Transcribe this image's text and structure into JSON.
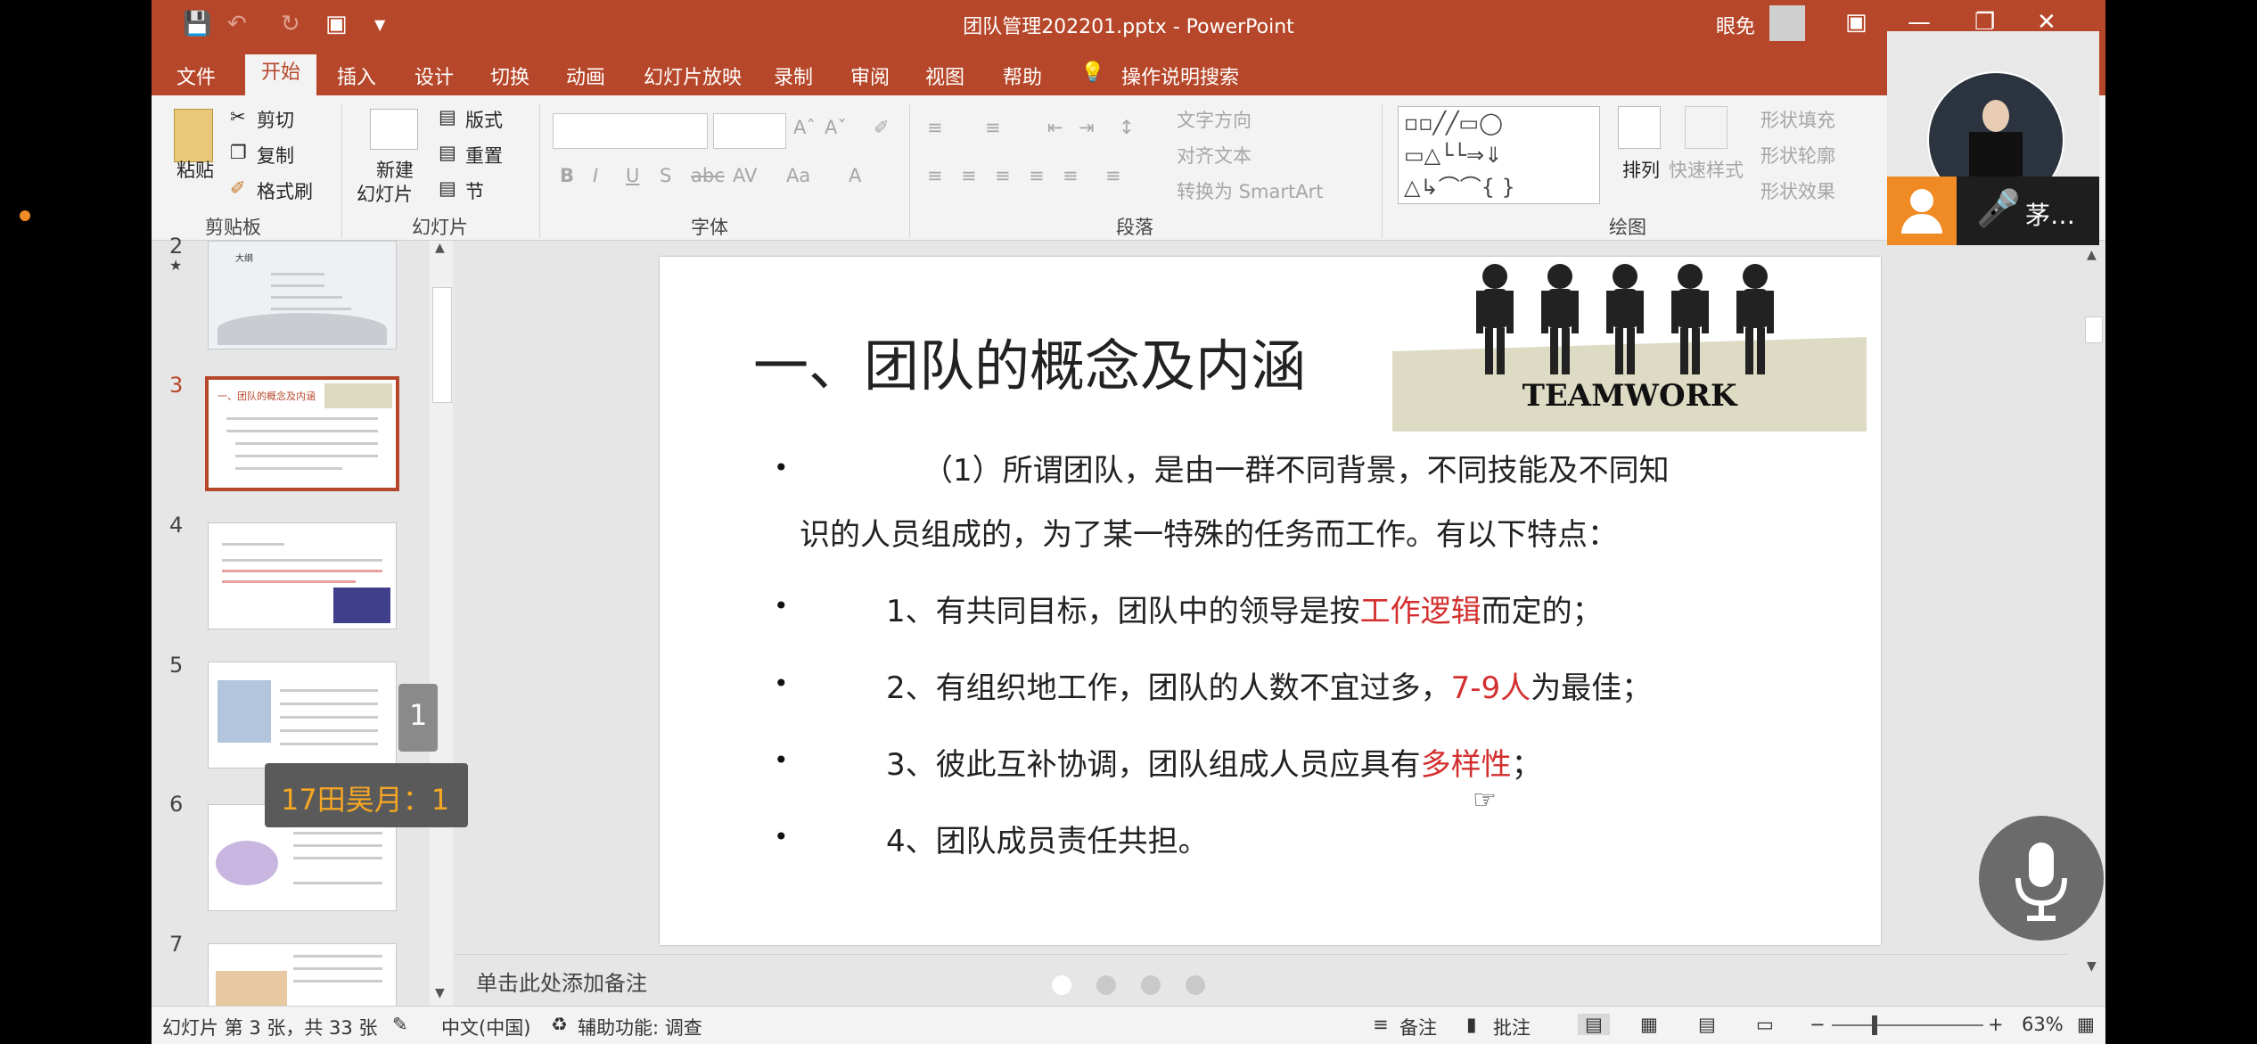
{
  "window": {
    "title": "团队管理202201.pptx - PowerPoint",
    "user": "眼免"
  },
  "tabs": [
    "文件",
    "开始",
    "插入",
    "设计",
    "切换",
    "动画",
    "幻灯片放映",
    "录制",
    "审阅",
    "视图",
    "帮助",
    "操作说明搜索"
  ],
  "ribbon": {
    "clipboard": {
      "paste": "粘贴",
      "cut": "剪切",
      "copy": "复制",
      "format_painter": "格式刷",
      "group": "剪贴板"
    },
    "slides": {
      "new_slide_line1": "新建",
      "new_slide_line2": "幻灯片",
      "layout": "版式",
      "reset": "重置",
      "section": "节",
      "group": "幻灯片"
    },
    "font": {
      "group": "字体",
      "bold": "B",
      "italic": "I",
      "underline": "U",
      "shadow": "S",
      "strike": "abc",
      "spacing": "AV",
      "case": "Aa",
      "color": "A"
    },
    "paragraph": {
      "text_direction": "文字方向",
      "align_text": "对齐文本",
      "convert_smartart": "转换为 SmartArt",
      "group": "段落"
    },
    "drawing": {
      "arrange": "排列",
      "quick_styles": "快速样式",
      "shape_fill": "形状填充",
      "shape_outline": "形状轮廓",
      "shape_effects": "形状效果",
      "group": "绘图"
    }
  },
  "thumbnails": [
    {
      "num": "2",
      "star": "★",
      "title": "大纲"
    },
    {
      "num": "3",
      "title": "一、团队的概念及内涵"
    },
    {
      "num": "4"
    },
    {
      "num": "5"
    },
    {
      "num": "6"
    },
    {
      "num": "7"
    }
  ],
  "slide": {
    "title": "一、团队的概念及内涵",
    "teamwork_label": "TEAMWORK",
    "bullet": "•",
    "p1_line1": "（1）所谓团队，是由一群不同背景，不同技能及不同知",
    "p1_line2": "识的人员组成的，为了某一特殊的任务而工作。有以下特点：",
    "p2_a": "1、有共同目标，团队中的领导是按",
    "p2_red": "工作逻辑",
    "p2_b": "而定的；",
    "p3_a": "2、有组织地工作，团队的人数不宜过多，",
    "p3_red": "7-9人",
    "p3_b": "为最佳；",
    "p4_a": "3、彼此互补协调，团队组成人员应具有",
    "p4_red": "多样性",
    "p4_b": "；",
    "p5": "4、团队成员责任共担。"
  },
  "notes_placeholder": "单击此处添加备注",
  "status": {
    "slide_info": "幻灯片 第 3 张，共 33 张",
    "language": "中文(中国)",
    "accessibility": "辅助功能: 调查",
    "notes": "备注",
    "comments": "批注",
    "zoom": "63%"
  },
  "overlays": {
    "video_name": "茅…",
    "tooltip": "17田昊月：1",
    "tooltip_badge": "1"
  }
}
